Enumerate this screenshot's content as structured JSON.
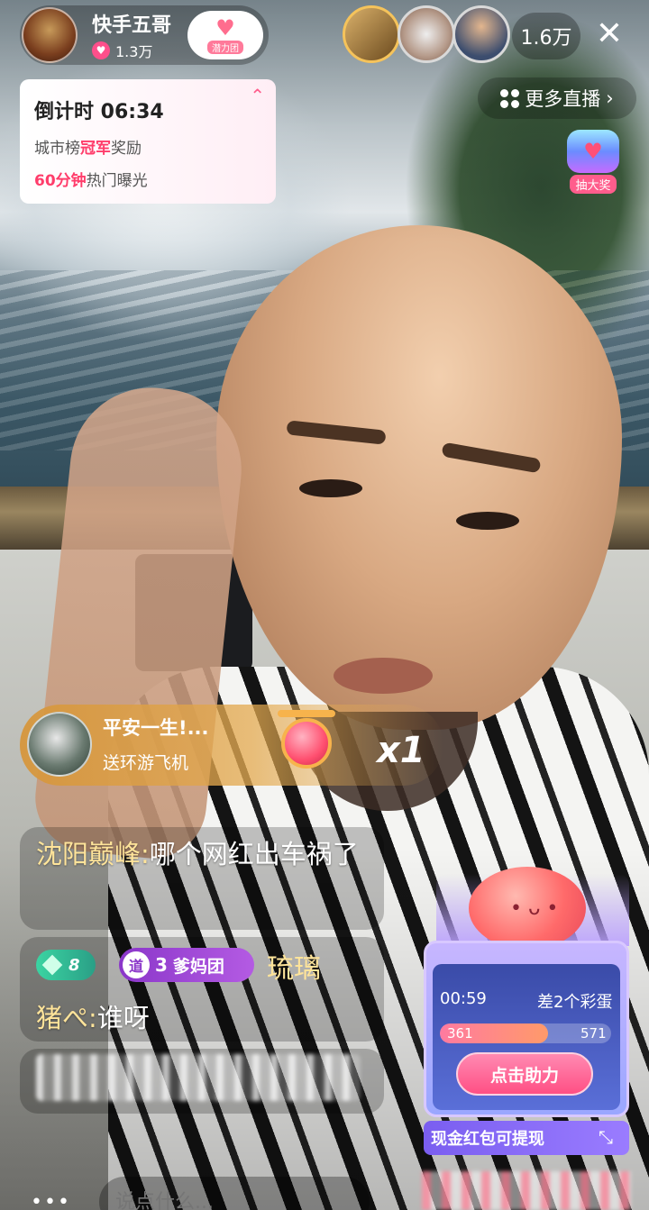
{
  "host": {
    "name": "快手五哥",
    "likes": "1.3万",
    "fanclub_label": "潜力团"
  },
  "viewers": {
    "count": "1.6万"
  },
  "more_live": {
    "label": "更多直播"
  },
  "lottery": {
    "label": "抽大奖"
  },
  "countdown": {
    "title": "倒计时 06:34",
    "line1_prefix": "城市榜",
    "line1_accent": "冠军",
    "line1_suffix": "奖励",
    "line2_accent": "60分钟",
    "line2_suffix": "热门曝光"
  },
  "gift": {
    "sender": "平安一生!...",
    "description": "送环游飞机",
    "count": "x1"
  },
  "chat": {
    "msg1_user": "沈阳巅峰:",
    "msg1_text": "哪个网红出车祸了",
    "level": "8",
    "fan_mark": "道",
    "fan_level": "3",
    "fan_group": "爹妈团",
    "fan_name": "琉璃",
    "msg2_user": "猪ぺ:",
    "msg2_text": "谁呀"
  },
  "input": {
    "placeholder": "说点什么..."
  },
  "help_card": {
    "timer": "00:59",
    "eggs": "差2个彩蛋",
    "current": "361",
    "target": "571",
    "progress": 0.63,
    "button": "点击助力",
    "cash": "现金红包可提现"
  },
  "colors": {
    "accent_pink": "#ff3d6b",
    "chat_username": "#ffe49a",
    "gift_gold": "#d6963c"
  },
  "icons": {
    "close": "close-icon",
    "grid": "grid-icon",
    "heart": "heart-icon",
    "expand": "expand-icon",
    "more": "more-dots-icon"
  }
}
